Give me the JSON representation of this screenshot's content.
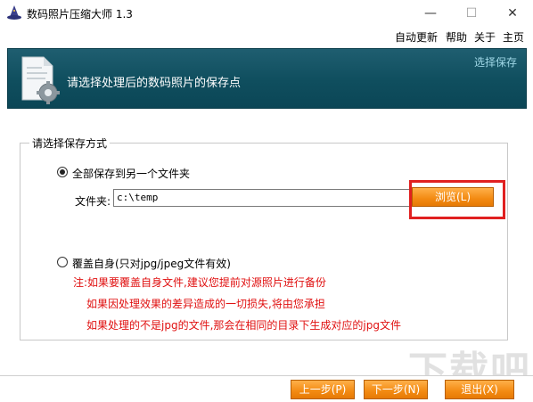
{
  "window": {
    "title": "数码照片压缩大师 1.3",
    "minimize_glyph": "—",
    "maximize_glyph": "☐",
    "close_glyph": "✕"
  },
  "menu": {
    "items": [
      "自动更新",
      "帮助",
      "关于",
      "主页"
    ]
  },
  "banner": {
    "text": "请选择处理后的数码照片的保存点",
    "top_label": "选择保存"
  },
  "save_group": {
    "legend": "请选择保存方式",
    "option_folder": "全部保存到另一个文件夹",
    "folder_label": "文件夹:",
    "folder_value": "c:\\temp",
    "browse_label": "浏览(L)",
    "option_overwrite": "覆盖自身(只对jpg/jpeg文件有效)",
    "selected": "option_folder",
    "notes": [
      "注:如果要覆盖自身文件,建议您提前对源照片进行备份",
      "如果因处理效果的差异造成的一切损失,将由您承担",
      "如果处理的不是jpg的文件,那会在相同的目录下生成对应的jpg文件"
    ]
  },
  "footer": {
    "prev_label": "上一步(P)",
    "next_label": "下一步(N)",
    "exit_label": "退出(X)"
  },
  "colors": {
    "banner_bg": "#0f4e5e",
    "button_orange": "#f38a12",
    "note_red": "#e01010",
    "highlight_red": "#e02020"
  },
  "watermark": "下载吧"
}
